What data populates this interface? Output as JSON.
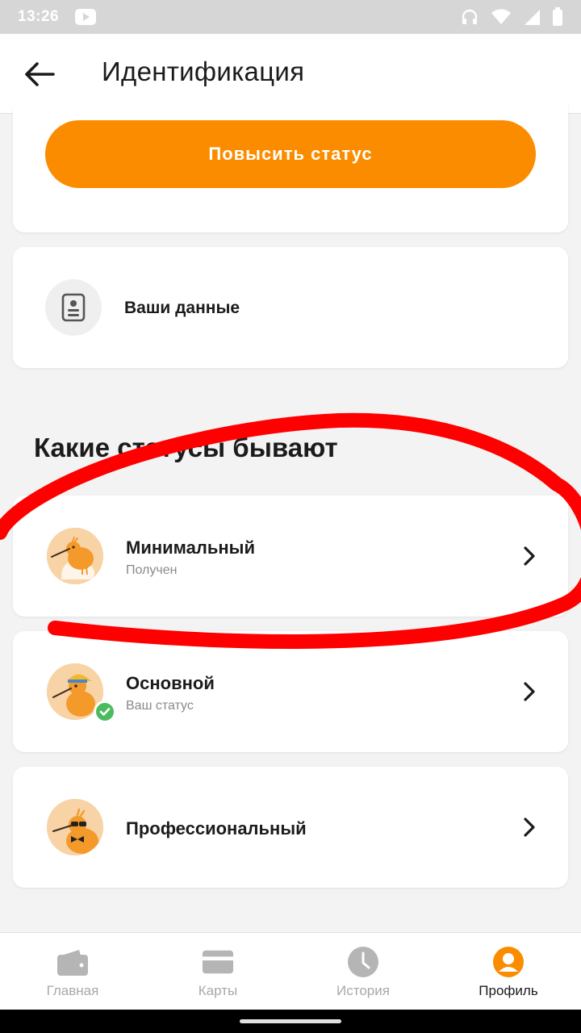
{
  "status_bar": {
    "time": "13:26",
    "icons": [
      "youtube-icon",
      "headphones-icon",
      "wifi-icon",
      "signal-icon",
      "battery-icon"
    ]
  },
  "appbar": {
    "back_icon": "arrow-left-icon",
    "title": "Идентификация"
  },
  "upgrade": {
    "button_label": "Повысить статус",
    "color": "#fb8c00"
  },
  "your_data": {
    "icon": "id-card-icon",
    "label": "Ваши данные"
  },
  "statuses": {
    "title": "Какие статусы бывают",
    "items": [
      {
        "name": "Минимальный",
        "subtitle": "Получен",
        "icon": "bird-hatchling-avatar"
      },
      {
        "name": "Основной",
        "subtitle": "Ваш статус",
        "icon": "bird-cap-avatar",
        "badge": "check-icon"
      },
      {
        "name": "Профессиональный",
        "subtitle": "",
        "icon": "bird-sunglasses-avatar"
      }
    ]
  },
  "bottom_nav": {
    "items": [
      {
        "label": "Главная",
        "icon": "wallet-icon",
        "active": false
      },
      {
        "label": "Карты",
        "icon": "card-icon",
        "active": false
      },
      {
        "label": "История",
        "icon": "clock-icon",
        "active": false
      },
      {
        "label": "Профиль",
        "icon": "profile-icon",
        "active": true
      }
    ]
  },
  "colors": {
    "accent": "#fb8c00",
    "annotation": "#ff0000",
    "success": "#4cbb5e"
  }
}
